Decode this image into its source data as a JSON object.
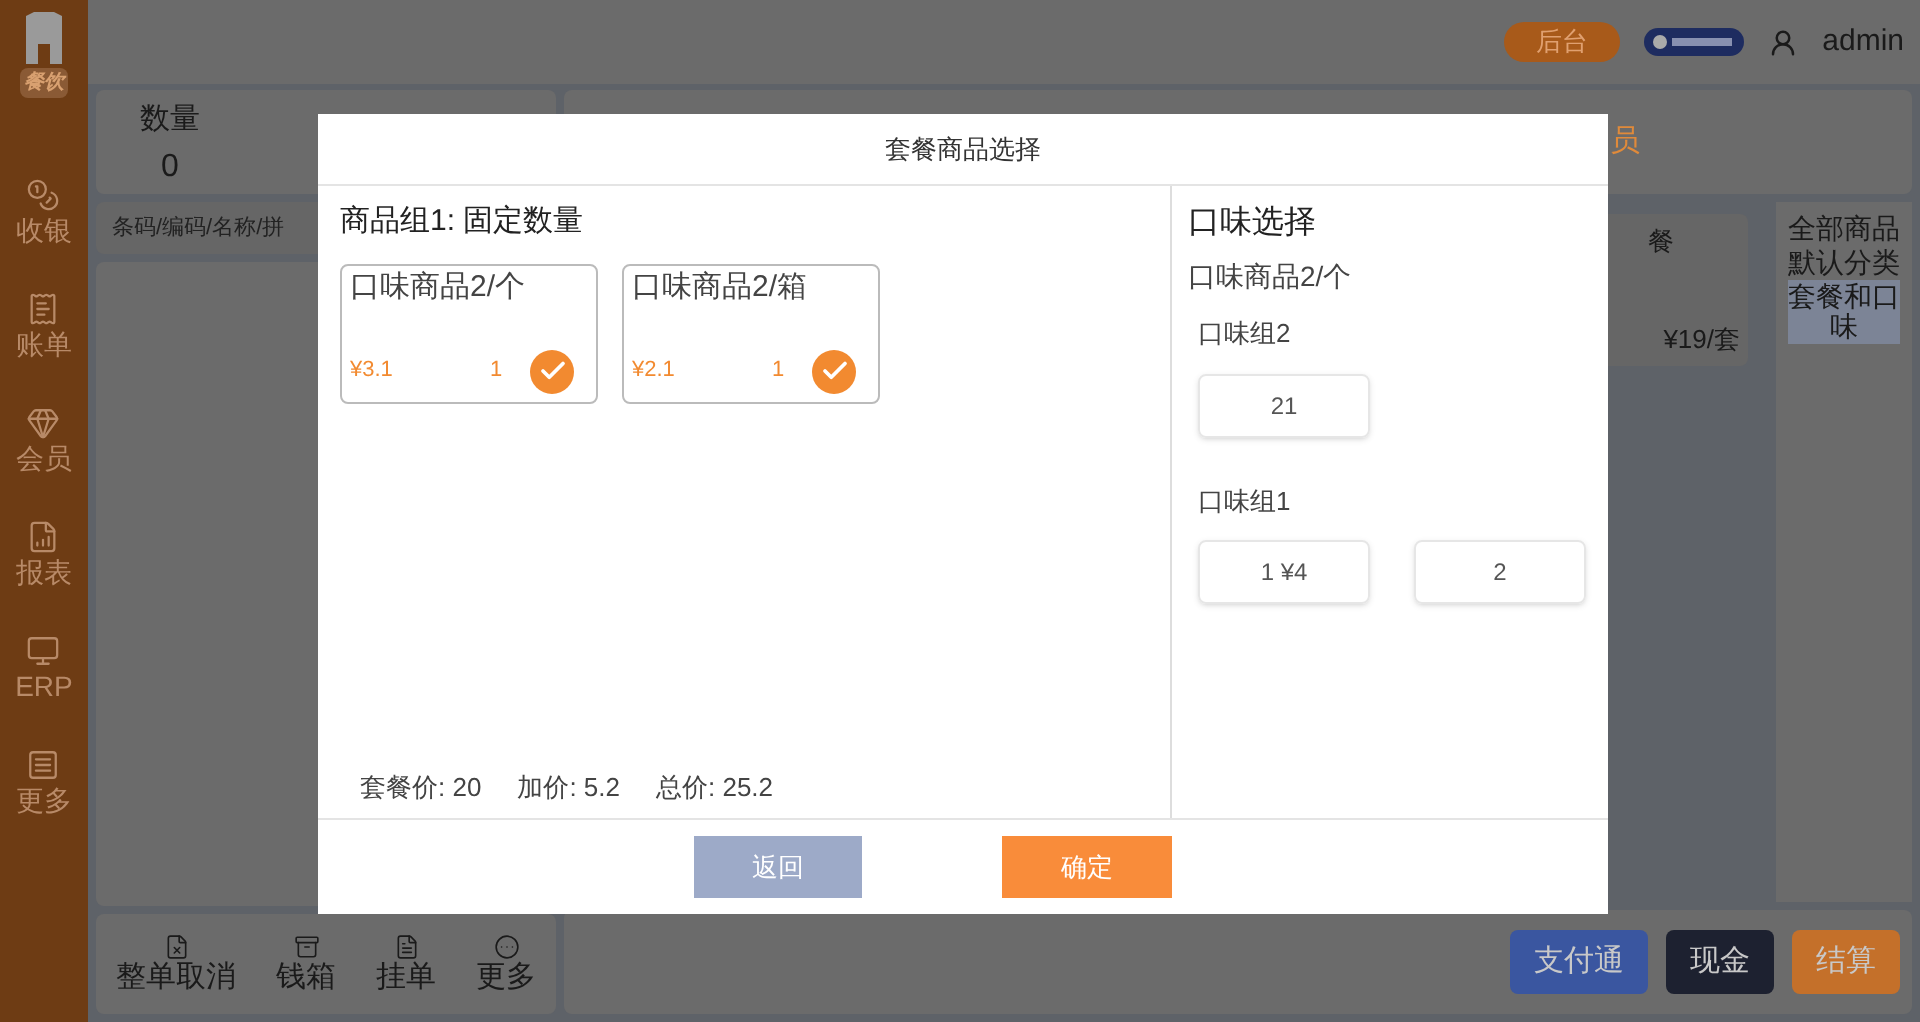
{
  "sidebar": {
    "logo": "餐饮",
    "items": [
      {
        "label": "收银"
      },
      {
        "label": "账单"
      },
      {
        "label": "会员"
      },
      {
        "label": "报表"
      },
      {
        "label": "ERP"
      },
      {
        "label": "更多"
      }
    ]
  },
  "header": {
    "backend_button": "后台",
    "user": "admin"
  },
  "cart": {
    "columns": [
      {
        "label": "数量",
        "value": "0"
      }
    ],
    "search": {
      "placeholder": "条码/编码/名称/拼"
    },
    "actions": [
      {
        "label": "整单取消"
      },
      {
        "label": "钱箱"
      },
      {
        "label": "挂单"
      },
      {
        "label": "更多"
      }
    ]
  },
  "summary": {
    "member": "员"
  },
  "products": [
    {
      "name": "餐",
      "price": "¥19/套"
    }
  ],
  "categories": [
    {
      "label": "全部商品",
      "selected": false
    },
    {
      "label": "默认分类",
      "selected": false
    },
    {
      "label": "套餐和口味",
      "selected": true
    }
  ],
  "payment_buttons": [
    {
      "label": "支付通",
      "color": "#3a56a0"
    },
    {
      "label": "现金",
      "color": "#1d2130"
    },
    {
      "label": "结算",
      "color": "#c4702a"
    }
  ],
  "dialog": {
    "title": "套餐商品选择",
    "group_title": "商品组1: 固定数量",
    "items": [
      {
        "name": "口味商品2/个",
        "price": "¥3.1",
        "qty": "1",
        "checked": true
      },
      {
        "name": "口味商品2/箱",
        "price": "¥2.1",
        "qty": "1",
        "checked": true
      }
    ],
    "totals": [
      "套餐价: 20",
      "加价: 5.2",
      "总价: 25.2"
    ],
    "flavor": {
      "title": "口味选择",
      "product": "口味商品2/个",
      "groups": [
        {
          "name": "口味组2",
          "options": [
            "21"
          ]
        },
        {
          "name": "口味组1",
          "options": [
            "1 ¥4",
            "2"
          ]
        }
      ]
    },
    "back_button": "返回",
    "confirm_button": "确定"
  }
}
